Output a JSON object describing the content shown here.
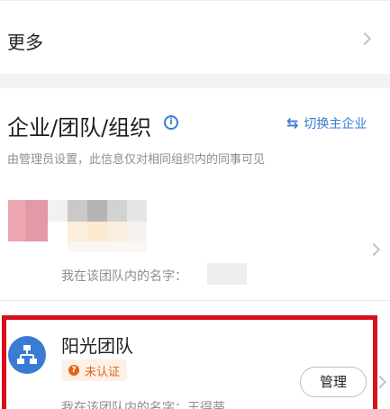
{
  "more": {
    "label": "更多"
  },
  "org_section": {
    "title": "企业/团队/组织",
    "switch_label": "切换主企业",
    "description": "由管理员设置，此信息仅对相同组织内的同事可见"
  },
  "org_card_1": {
    "member_name_label": "我在该团队内的名字："
  },
  "team_card": {
    "name": "阳光团队",
    "badge": "未认证",
    "manage_label": "管理",
    "member_name_label": "我在该团队内的名字：王得蒂"
  },
  "colors": {
    "accent": "#3a7bd5",
    "badge_text": "#e2651f",
    "badge_bg": "#fdf0e6",
    "highlight": "#d9101b"
  }
}
